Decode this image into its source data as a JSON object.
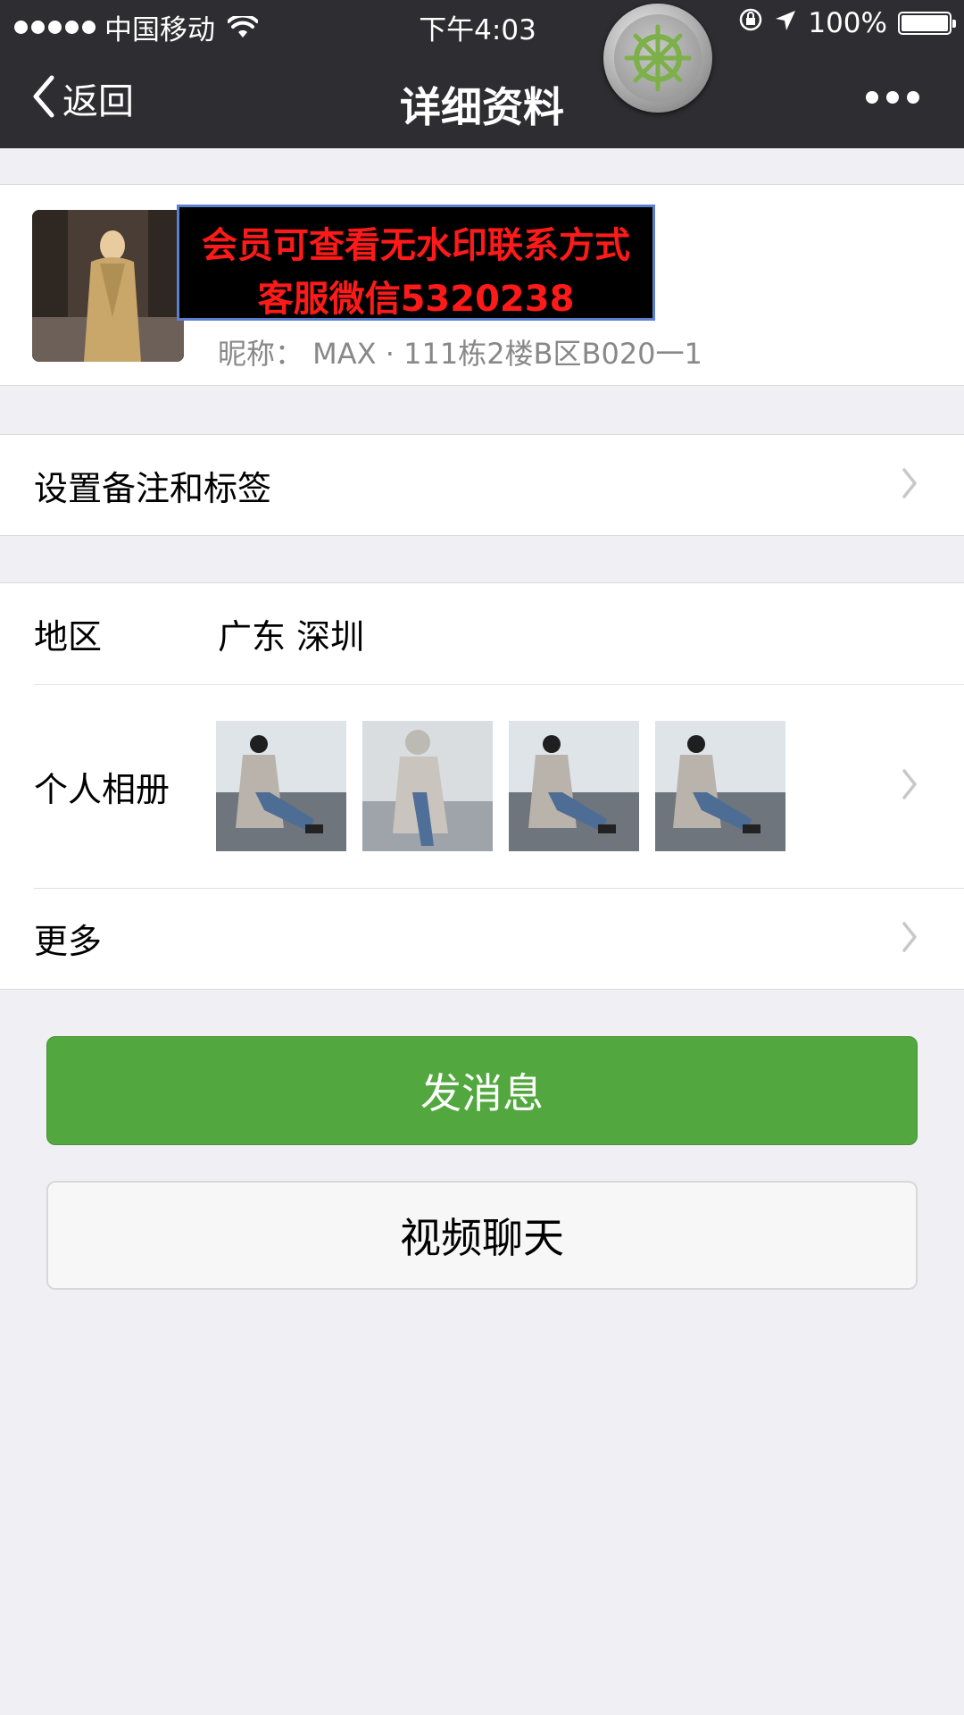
{
  "status_bar": {
    "carrier": "中国移动",
    "time": "下午4:03",
    "battery": "100%"
  },
  "nav": {
    "back_label": "返回",
    "title": "详细资料"
  },
  "profile": {
    "watermark_line1": "会员可查看无水印联系方式",
    "watermark_line2": "客服微信5320238",
    "nickname": "昵称：  MAX · 111栋2楼B区B020一1"
  },
  "cells": {
    "remark": "设置备注和标签",
    "region_label": "地区",
    "region_value": "广东 深圳",
    "album_label": "个人相册",
    "more_label": "更多"
  },
  "buttons": {
    "send_message": "发消息",
    "video_chat": "视频聊天"
  },
  "colors": {
    "header_bg": "#2e2e32",
    "primary_green": "#52a83e",
    "watermark_red": "#ff1a1a"
  }
}
